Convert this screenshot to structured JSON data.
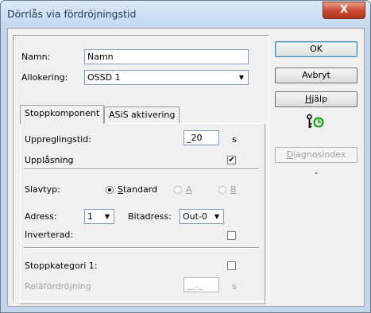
{
  "window": {
    "title": "Dörrlås via fördröjningstid",
    "close_glyph": "X"
  },
  "form": {
    "name_label": "Namn:",
    "name_value": "Namn",
    "alloc_label": "Allokering:",
    "alloc_value": "OSSD 1"
  },
  "tabs": [
    {
      "label": "Stoppkomponent",
      "active": true
    },
    {
      "label": "ASiS aktivering",
      "active": false
    }
  ],
  "stop": {
    "uppreg_label": "Uppreglingstid:",
    "uppreg_value": "_20",
    "uppreg_unit": "s",
    "upplas_label": "Upplåsning",
    "upplas_checked": "✔",
    "slav_label": "Slavtyp:",
    "slav_options": [
      {
        "prefix": "",
        "accel": "S",
        "rest": "tandard",
        "selected": true,
        "enabled": true
      },
      {
        "prefix": "",
        "accel": "A",
        "rest": "",
        "selected": false,
        "enabled": false
      },
      {
        "prefix": "",
        "accel": "B",
        "rest": "",
        "selected": false,
        "enabled": false
      }
    ],
    "adress_label": "Adress:",
    "adress_value": "1",
    "bitadress_label": "Bitadress:",
    "bitadress_value": "Out-0",
    "inverterad_label": "Inverterad:",
    "stoppkat_label": "Stoppkategori 1:",
    "rele_label": "Reläfördröjning",
    "rele_value": "__._",
    "rele_unit": "s"
  },
  "buttons": {
    "ok": "OK",
    "avbryt": "Avbryt",
    "hjalp_accel": "H",
    "hjalp_rest": "jälp",
    "diag_accel": "D",
    "diag_rest": "iagnosindex",
    "dash": "-"
  },
  "icon": {
    "name": "key-timer-icon",
    "key_color": "#000000",
    "clock_color": "#00a000"
  }
}
